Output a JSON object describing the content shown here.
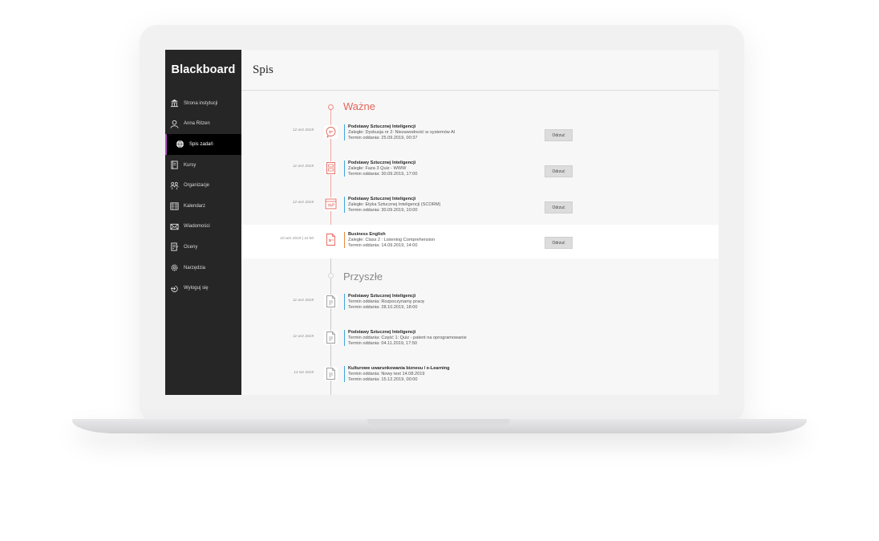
{
  "brand": "Blackboard",
  "nav": [
    {
      "label": "Strona instytucji",
      "icon": "institution-icon"
    },
    {
      "label": "Anna Ritzen",
      "icon": "user-icon"
    },
    {
      "label": "Spis zadań",
      "icon": "globe-icon",
      "active": true
    },
    {
      "label": "Kursy",
      "icon": "book-icon"
    },
    {
      "label": "Organizacje",
      "icon": "people-icon"
    },
    {
      "label": "Kalendarz",
      "icon": "calendar-icon"
    },
    {
      "label": "Wiadomości",
      "icon": "mail-icon"
    },
    {
      "label": "Oceny",
      "icon": "grades-icon"
    },
    {
      "label": "Narzędzia",
      "icon": "gear-icon"
    },
    {
      "label": "Wyloguj się",
      "icon": "logout-icon"
    }
  ],
  "page": {
    "title": "Spis"
  },
  "sections": {
    "important": {
      "title": "Ważne"
    },
    "upcoming": {
      "title": "Przyszłe"
    }
  },
  "important_items": [
    {
      "date": "12 wrz 2019",
      "course": "Podstawy Sztucznej Inteligencji",
      "line2": "Zaległe: Dyskusja nr 2: Niezawodność w systemów AI",
      "line3": "Termin oddania: 25.09.2019, 00:37",
      "button": "Odrzuć",
      "icon": "discussion-icon"
    },
    {
      "date": "11 wrz 2019",
      "course": "Podstawy Sztucznej Inteligencji",
      "line2": "Zaległe: Faza 3 Quiz - WWW",
      "line3": "Termin oddania: 30.09.2019, 17:00",
      "button": "Odrzuć",
      "icon": "quiz-icon"
    },
    {
      "date": "12 wrz 2019",
      "course": "Podstawy Sztucznej Inteligencji",
      "line2": "Zaległe: Etyka Sztucznej Inteligencji (SCORM)",
      "line3": "Termin oddania: 30.09.2019, 10:00",
      "button": "Odrzuć",
      "icon": "scorm-icon"
    },
    {
      "date": "10 wrz 2019  |  11:50",
      "course": "Business English",
      "line2": "Zaległe: Class 2 : Listening Comprehension",
      "line3": "Termin oddania: 14.09.2019, 14:00",
      "button": "Odrzuć",
      "icon": "assignment-icon"
    }
  ],
  "upcoming_items": [
    {
      "date": "11 wrz 2019",
      "course": "Podstawy Sztucznej Inteligencji",
      "line2": "Termin oddania: Rozpoczynamy pracę",
      "line3": "Termin oddania: 28.10.2019, 18:00",
      "icon": "document-icon"
    },
    {
      "date": "11 wrz 2019",
      "course": "Podstawy Sztucznej Inteligencji",
      "line2": "Termin oddania: Część 1: Quiz - patent na oprogramowanie",
      "line3": "Termin oddania: 04.11.2019, 17:50",
      "icon": "document-icon"
    },
    {
      "date": "14 sie 2019",
      "course": "Kulturowe uwarunkowania biznesu / e-Learning",
      "line2": "Termin oddania: Nowy test 14.08.2019",
      "line3": "Termin oddania: 15.12.2019, 00:00",
      "icon": "document-icon"
    }
  ],
  "colors": {
    "accent_red": "#e4655c",
    "accent_blue": "#3fa6d9",
    "accent_orange": "#e8893c",
    "active_marker": "#b34cc0"
  }
}
